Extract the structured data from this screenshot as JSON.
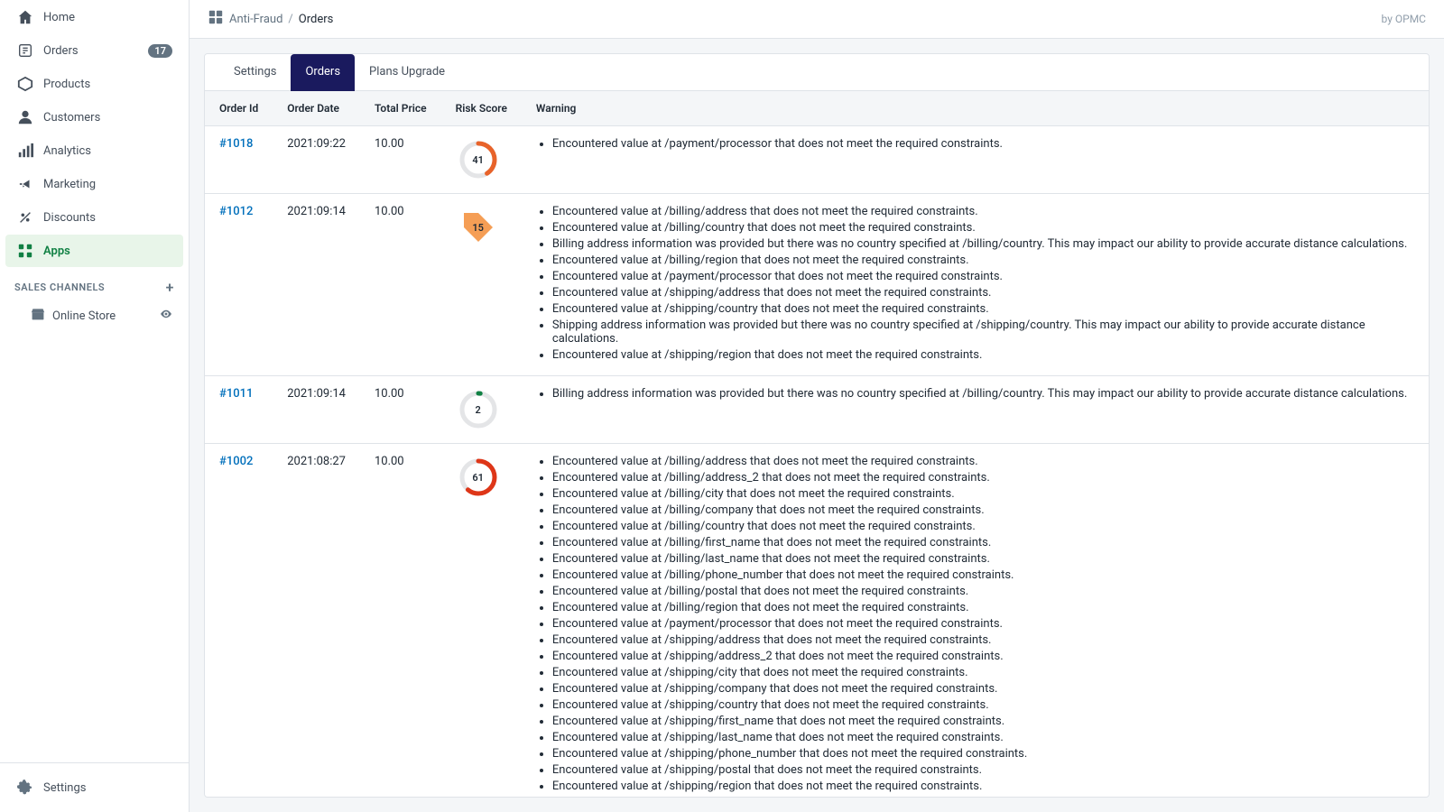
{
  "sidebar": {
    "nav_items": [
      {
        "id": "home",
        "label": "Home",
        "icon": "home",
        "badge": null,
        "active": false
      },
      {
        "id": "orders",
        "label": "Orders",
        "icon": "orders",
        "badge": "17",
        "active": false
      },
      {
        "id": "products",
        "label": "Products",
        "icon": "products",
        "badge": null,
        "active": false
      },
      {
        "id": "customers",
        "label": "Customers",
        "icon": "customers",
        "badge": null,
        "active": false
      },
      {
        "id": "analytics",
        "label": "Analytics",
        "icon": "analytics",
        "badge": null,
        "active": false
      },
      {
        "id": "marketing",
        "label": "Marketing",
        "icon": "marketing",
        "badge": null,
        "active": false
      },
      {
        "id": "discounts",
        "label": "Discounts",
        "icon": "discounts",
        "badge": null,
        "active": false
      },
      {
        "id": "apps",
        "label": "Apps",
        "icon": "apps",
        "badge": null,
        "active": true
      }
    ],
    "sales_channels_label": "SALES CHANNELS",
    "sales_channels": [
      {
        "id": "online-store",
        "label": "Online Store"
      }
    ],
    "bottom_item": {
      "id": "settings",
      "label": "Settings",
      "icon": "settings"
    }
  },
  "header": {
    "breadcrumb_icon": "anti-fraud-icon",
    "breadcrumb_app": "Anti-Fraud",
    "breadcrumb_separator": "/",
    "breadcrumb_current": "Orders",
    "by_label": "by OPMC"
  },
  "tabs": [
    {
      "id": "settings",
      "label": "Settings",
      "active": false
    },
    {
      "id": "orders",
      "label": "Orders",
      "active": true
    },
    {
      "id": "plans-upgrade",
      "label": "Plans Upgrade",
      "active": false
    }
  ],
  "table": {
    "columns": [
      {
        "id": "order-id",
        "label": "Order Id"
      },
      {
        "id": "order-date",
        "label": "Order Date"
      },
      {
        "id": "total-price",
        "label": "Total Price"
      },
      {
        "id": "risk-score",
        "label": "Risk Score"
      },
      {
        "id": "warning",
        "label": "Warning"
      }
    ],
    "rows": [
      {
        "order_id": "#1018",
        "order_date": "2021:09:22",
        "total_price": "10.00",
        "risk_score": 41,
        "risk_color": "#e8632a",
        "risk_type": "orange",
        "warnings": [
          "Encountered value at /payment/processor that does not meet the required constraints."
        ]
      },
      {
        "order_id": "#1012",
        "order_date": "2021:09:14",
        "total_price": "10.00",
        "risk_score": 15,
        "risk_color": "#f49342",
        "risk_type": "yellow",
        "warnings": [
          "Encountered value at /billing/address that does not meet the required constraints.",
          "Encountered value at /billing/country that does not meet the required constraints.",
          "Billing address information was provided but there was no country specified at /billing/country. This may impact our ability to provide accurate distance calculations.",
          "Encountered value at /billing/region that does not meet the required constraints.",
          "Encountered value at /payment/processor that does not meet the required constraints.",
          "Encountered value at /shipping/address that does not meet the required constraints.",
          "Encountered value at /shipping/country that does not meet the required constraints.",
          "Shipping address information was provided but there was no country specified at /shipping/country. This may impact our ability to provide accurate distance calculations.",
          "Encountered value at /shipping/region that does not meet the required constraints."
        ]
      },
      {
        "order_id": "#1011",
        "order_date": "2021:09:14",
        "total_price": "10.00",
        "risk_score": 2,
        "risk_color": "#108043",
        "risk_type": "green",
        "warnings": [
          "Billing address information was provided but there was no country specified at /billing/country. This may impact our ability to provide accurate distance calculations."
        ]
      },
      {
        "order_id": "#1002",
        "order_date": "2021:08:27",
        "total_price": "10.00",
        "risk_score": 61,
        "risk_color": "#de3618",
        "risk_type": "red",
        "warnings": [
          "Encountered value at /billing/address that does not meet the required constraints.",
          "Encountered value at /billing/address_2 that does not meet the required constraints.",
          "Encountered value at /billing/city that does not meet the required constraints.",
          "Encountered value at /billing/company that does not meet the required constraints.",
          "Encountered value at /billing/country that does not meet the required constraints.",
          "Encountered value at /billing/first_name that does not meet the required constraints.",
          "Encountered value at /billing/last_name that does not meet the required constraints.",
          "Encountered value at /billing/phone_number that does not meet the required constraints.",
          "Encountered value at /billing/postal that does not meet the required constraints.",
          "Encountered value at /billing/region that does not meet the required constraints.",
          "Encountered value at /payment/processor that does not meet the required constraints.",
          "Encountered value at /shipping/address that does not meet the required constraints.",
          "Encountered value at /shipping/address_2 that does not meet the required constraints.",
          "Encountered value at /shipping/city that does not meet the required constraints.",
          "Encountered value at /shipping/company that does not meet the required constraints.",
          "Encountered value at /shipping/country that does not meet the required constraints.",
          "Encountered value at /shipping/first_name that does not meet the required constraints.",
          "Encountered value at /shipping/last_name that does not meet the required constraints.",
          "Encountered value at /shipping/phone_number that does not meet the required constraints.",
          "Encountered value at /shipping/postal that does not meet the required constraints.",
          "Encountered value at /shipping/region that does not meet the required constraints."
        ]
      }
    ]
  }
}
